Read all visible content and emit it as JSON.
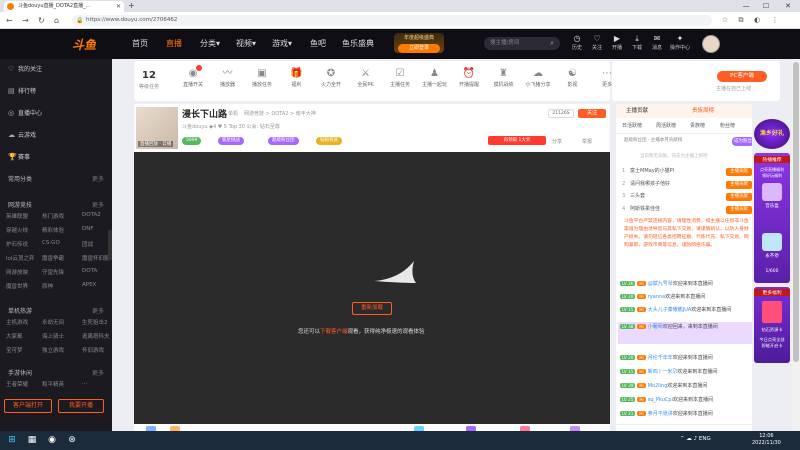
{
  "browser": {
    "tab_title": "斗鱼douyu直播_DOTA2直播_...",
    "url": "https://www.douyu.com/2706462",
    "new_tab": "+",
    "minimize": "—",
    "maximize": "☐",
    "close": "✕"
  },
  "header": {
    "logo": "斗鱼",
    "nav": [
      "首页",
      "直播",
      "分类▾",
      "视频▾",
      "游戏▾",
      "鱼吧",
      "鱼乐盛典"
    ],
    "active_nav": "直播",
    "promo_line1": "年度超级盛典",
    "promo_line2": "立即登录",
    "search_placeholder": "搜主播/房间",
    "icons": [
      {
        "label": "历史",
        "glyph": "◷",
        "icon": "history-icon"
      },
      {
        "label": "关注",
        "glyph": "♡",
        "icon": "heart-icon"
      },
      {
        "label": "开播",
        "glyph": "▶",
        "icon": "broadcast-icon"
      },
      {
        "label": "下载",
        "glyph": "⤓",
        "icon": "download-icon"
      },
      {
        "label": "消息",
        "glyph": "✉",
        "icon": "message-icon"
      },
      {
        "label": "操作中心",
        "glyph": "✦",
        "icon": "center-icon"
      }
    ]
  },
  "sidebar": {
    "items": [
      {
        "label": "我的关注",
        "glyph": "♡"
      },
      {
        "label": "排行榜",
        "glyph": "▤"
      },
      {
        "label": "直播中心",
        "glyph": "◎"
      },
      {
        "label": "云游戏",
        "glyph": "☁"
      }
    ],
    "bottom_icons": [
      {
        "label": "赛事",
        "glyph": "🏆"
      }
    ],
    "common_section": "常用分类",
    "common_more": "更多",
    "sections": [
      {
        "title": "网游竞技",
        "more": "更多",
        "rows": [
          [
            "英雄联盟",
            "热门游戏",
            "DOTA2"
          ],
          [
            "穿越火线",
            "精彩体验",
            "DNF"
          ],
          [
            "炉石传说",
            "CS:GO",
            "团战"
          ],
          [
            "lol云顶之弈",
            "魔兽争霸",
            "魔兽怀旧服"
          ],
          [
            "网游放映",
            "守望先锋",
            "DOTA"
          ],
          [
            "魔兽世界",
            "原神",
            "APEX"
          ]
        ]
      },
      {
        "title": "单机热游",
        "more": "更多",
        "rows": [
          [
            "主机游戏",
            "永劫无间",
            "生死狙击2"
          ],
          [
            "大家都",
            "海上骑士",
            "逃离塔科夫"
          ],
          [
            "宝可梦",
            "独立游戏",
            "怀旧游戏"
          ]
        ]
      },
      {
        "title": "手游休闲",
        "more": "更多",
        "rows": [
          [
            "王者荣耀",
            "和平精英",
            "..."
          ]
        ]
      }
    ],
    "btn_client": "客户端打开",
    "btn_broadcast": "我要开播"
  },
  "toolbar": {
    "level": "12",
    "level_label": "等级任务",
    "tools": [
      {
        "label": "直播开关",
        "glyph": "◉"
      },
      {
        "label": "播放器",
        "glyph": "〰"
      },
      {
        "label": "播放任务",
        "glyph": "▣"
      },
      {
        "label": "福利",
        "glyph": "🎁"
      },
      {
        "label": "火力全开",
        "glyph": "✪"
      },
      {
        "label": "全民PK",
        "glyph": "⚔"
      },
      {
        "label": "主播任务",
        "glyph": "☑"
      },
      {
        "label": "主播一起玩",
        "glyph": "♟"
      },
      {
        "label": "开播提醒",
        "glyph": "⏰"
      },
      {
        "label": "摸机战绩",
        "glyph": "♜"
      },
      {
        "label": "小飞猪分享",
        "glyph": "☁"
      },
      {
        "label": "影视",
        "glyph": "☯"
      },
      {
        "label": "更多",
        "glyph": "⋯"
      }
    ],
    "pc_client": "PC客户端",
    "pc_hint": "主播在自己上线"
  },
  "room": {
    "thumb_tag": "直播回放 · 云播",
    "title": "漫长下山路",
    "type": "单机",
    "category": "网游竞技 > DOTA2 > 南丰大神",
    "host_line": "斗鱼douyu  ◆4  ♥ 5  Top 30  公会: 钻石至尊",
    "pills": [
      {
        "label": "5999",
        "color": "#58b85e"
      },
      {
        "label": "狐星挑战",
        "color": "#a569ff"
      },
      {
        "label": "超级粉丝团",
        "color": "#a569ff"
      },
      {
        "label": "钻粉贵族",
        "color": "#e6b422"
      }
    ],
    "viewers": "21126S",
    "follow": "关注",
    "hot_badge": "再领取 1大奖",
    "share": "分享",
    "report": "举报"
  },
  "player": {
    "open_btn": "重新加载",
    "hint_prefix": "您还可以",
    "hint_link": "下载客户端",
    "hint_suffix": "观看，获得纯净极速的观看体验"
  },
  "chat": {
    "tabs": [
      "主播贡献",
      "贵族周榜"
    ],
    "subtabs": [
      "日活跃榜",
      "周活跃榜",
      "贵族榜",
      "粉丝榜"
    ],
    "rank_line": "超级粉丝团 · 主播本月贡献榜",
    "join": "成为粉丝",
    "rank_empty": "当前暂无贡献，快去为主播上榜吧",
    "rank_rows": [
      {
        "num": "1",
        "name": "富士MMay的小猫PI"
      },
      {
        "num": "2",
        "name": "请问我哪孩子他好"
      },
      {
        "num": "3",
        "name": "三头套"
      },
      {
        "num": "4",
        "name": "阿斯铁柔佳佳"
      }
    ],
    "rank_badge": "主播贡献",
    "notice": "斗鱼平台严禁违规内容，请理性消费，如主播以任何非斗鱼渠道为理由诱导您与其私下交易，请谨慎辨认，以防人身财产损失。请勿轻信各类招聘征婚、代练代充、私下交易、网购兼职、游戏币商等信息，谨防网络诈骗。",
    "messages": [
      {
        "lv": "LV 26",
        "name": "@斌九号琴",
        "text": "欢迎来到本直播间"
      },
      {
        "lv": "LV 20",
        "name": "ryanna",
        "text": "欢迎来到本直播间"
      },
      {
        "lv": "LV 15",
        "name": "大头儿子秦耀鹏JUA",
        "text": "欢迎来到本直播间"
      },
      {
        "lv": "LV 38",
        "name": "小葡萄",
        "text": "欢迎回来，来到本直播间"
      },
      {
        "lv": "LV 20",
        "name": "月伦千年年",
        "text": "欢迎来到本直播间"
      },
      {
        "lv": "LV 15",
        "name": "新四 l 一米尕",
        "text": "欢迎来到本直播间"
      },
      {
        "lv": "LV 39",
        "name": "Mo2ling",
        "text": "欢迎来到本直播间"
      },
      {
        "lv": "LV 25",
        "name": "sq_PkuCpi",
        "text": "欢迎来到本直播间"
      },
      {
        "lv": "LV 21",
        "name": "参月不道讲",
        "text": "欢迎来到本直播间"
      }
    ]
  },
  "promos": {
    "seal": "渔乡好礼",
    "panel_title": "热播推荐",
    "panel_sub": "点亮直播福利\n领好玩福利",
    "items": [
      "音乐盒",
      "永不停"
    ],
    "page": "1/600",
    "more_title": "更多福利",
    "card_text": "钻石资源卡",
    "card_sub": "今日点亮全部\n即能开启卡"
  },
  "taskbar": {
    "tray": "⌃  ☁  ♪  ENG",
    "time": "12:06",
    "date": "2022/11/30"
  }
}
